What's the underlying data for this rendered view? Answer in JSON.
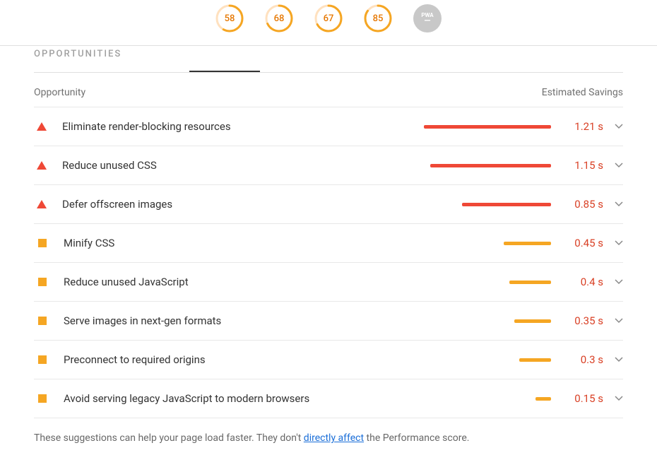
{
  "scores": [
    {
      "value": "58",
      "pct": 58,
      "color": "#f5a623"
    },
    {
      "value": "68",
      "pct": 68,
      "color": "#f5a623"
    },
    {
      "value": "67",
      "pct": 67,
      "color": "#f5a623"
    },
    {
      "value": "85",
      "pct": 85,
      "color": "#f5a623"
    }
  ],
  "pwa_label": "PWA",
  "section_title": "OPPORTUNITIES",
  "header": {
    "opportunity": "Opportunity",
    "savings": "Estimated Savings"
  },
  "opportunities": [
    {
      "severity": "high",
      "label": "Eliminate render-blocking resources",
      "savings": "1.21 s",
      "bar_pct": 100
    },
    {
      "severity": "high",
      "label": "Reduce unused CSS",
      "savings": "1.15 s",
      "bar_pct": 95
    },
    {
      "severity": "high",
      "label": "Defer offscreen images",
      "savings": "0.85 s",
      "bar_pct": 70
    },
    {
      "severity": "med",
      "label": "Minify CSS",
      "savings": "0.45 s",
      "bar_pct": 37
    },
    {
      "severity": "med",
      "label": "Reduce unused JavaScript",
      "savings": "0.4 s",
      "bar_pct": 33
    },
    {
      "severity": "med",
      "label": "Serve images in next-gen formats",
      "savings": "0.35 s",
      "bar_pct": 29
    },
    {
      "severity": "med",
      "label": "Preconnect to required origins",
      "savings": "0.3 s",
      "bar_pct": 25
    },
    {
      "severity": "med",
      "label": "Avoid serving legacy JavaScript to modern browsers",
      "savings": "0.15 s",
      "bar_pct": 12
    }
  ],
  "footnote": {
    "prefix": "These suggestions can help your page load faster. They don't ",
    "link": "directly affect",
    "suffix": " the Performance score."
  }
}
